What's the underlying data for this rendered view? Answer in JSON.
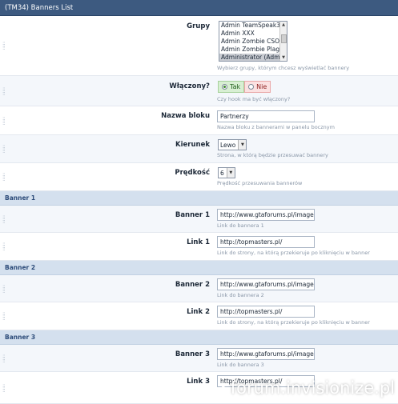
{
  "title": "(TM34) Banners List",
  "grupy": {
    "label": "Grupy",
    "options": [
      "Admin TeamSpeak3",
      "Admin XXX",
      "Admin Zombie CSO",
      "Admin Zombie Plague",
      "Administrator (Admin)"
    ],
    "selected": "Administrator (Admin)",
    "desc": "Wybierz grupy, którym chcesz wyświetlać bannery"
  },
  "wlaczony": {
    "label": "Włączony?",
    "yes": "Tak",
    "no": "Nie",
    "value": "Tak",
    "desc": "Czy hook ma być włączony?"
  },
  "nazwa_bloku": {
    "label": "Nazwa bloku",
    "value": "Partnerzy",
    "desc": "Nazwa bloku z bannerami w panelu bocznym"
  },
  "kierunek": {
    "label": "Kierunek",
    "value": "Lewo",
    "desc": "Strona, w którą będzie przesuwać bannery"
  },
  "predkosc": {
    "label": "Prędkość",
    "value": "6",
    "desc": "Prędkość przesuwania bannerów"
  },
  "banners": [
    {
      "section": "Banner 1",
      "banner_label": "Banner 1",
      "banner_value": "http://www.gtaforums.pl/images/Wol",
      "banner_desc": "Link do bannera 1",
      "link_label": "Link 1",
      "link_value": "http://topmasters.pl/",
      "link_desc": "Link do strony, na którą przekieruje po kliknięciu w banner"
    },
    {
      "section": "Banner 2",
      "banner_label": "Banner 2",
      "banner_value": "http://www.gtaforums.pl/images/Wol",
      "banner_desc": "Link do bannera 2",
      "link_label": "Link 2",
      "link_value": "http://topmasters.pl/",
      "link_desc": "Link do strony, na którą przekieruje po kliknięciu w banner"
    },
    {
      "section": "Banner 3",
      "banner_label": "Banner 3",
      "banner_value": "http://www.gtaforums.pl/images/Wol",
      "banner_desc": "Link do bannera 3",
      "link_label": "Link 3",
      "link_value": "http://topmasters.pl/",
      "link_desc": ""
    }
  ],
  "watermark": "forum.invisionize.pl",
  "colors": {
    "header": "#3d5a80",
    "section": "#d4e0ee",
    "section_text": "#2b4a78",
    "yes_bg": "#d8efd3",
    "no_bg": "#fbe1e1"
  }
}
